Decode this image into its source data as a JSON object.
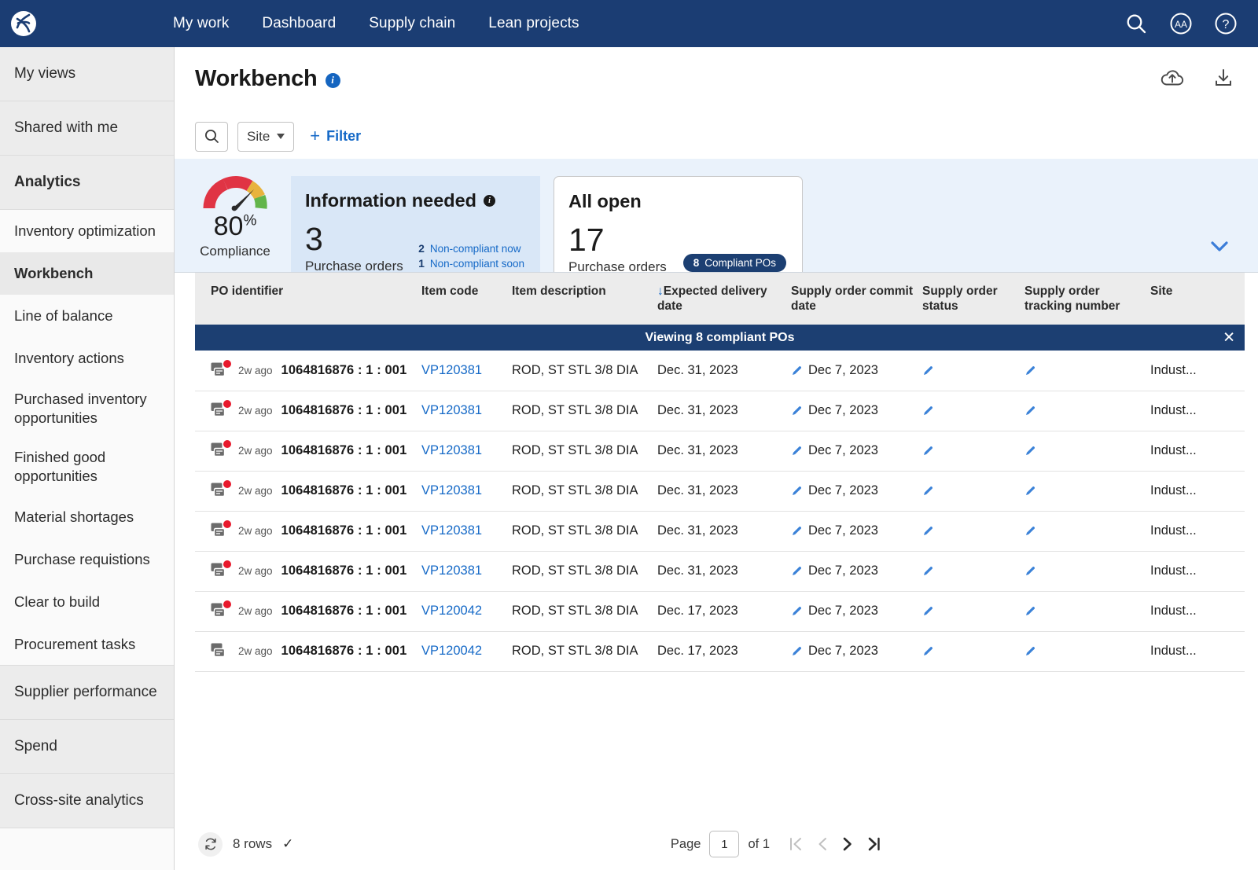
{
  "topnav": {
    "logo_icon": "brand-logo-icon",
    "links": [
      {
        "label": "My work"
      },
      {
        "label": "Dashboard"
      },
      {
        "label": "Supply chain"
      },
      {
        "label": "Lean projects"
      }
    ],
    "actions": [
      {
        "icon": "search-icon"
      },
      {
        "icon": "text-size-aa-icon"
      },
      {
        "icon": "help-question-icon"
      }
    ],
    "bg_color": "#1b3d73"
  },
  "sidebar": {
    "items": [
      {
        "label": "My views",
        "type": "group"
      },
      {
        "label": "Shared with me",
        "type": "group"
      },
      {
        "label": "Analytics",
        "type": "group-bold"
      },
      {
        "label": "Inventory optimization",
        "type": "sub"
      },
      {
        "label": "Workbench",
        "type": "sub-active"
      },
      {
        "label": "Line of balance",
        "type": "sub"
      },
      {
        "label": "Inventory actions",
        "type": "sub"
      },
      {
        "label": "Purchased inventory opportunities",
        "type": "sub2"
      },
      {
        "label": "Finished good opportunities",
        "type": "sub2"
      },
      {
        "label": "Material shortages",
        "type": "sub"
      },
      {
        "label": "Purchase requistions",
        "type": "sub"
      },
      {
        "label": "Clear to build",
        "type": "sub"
      },
      {
        "label": "Procurement tasks",
        "type": "sub-last"
      },
      {
        "label": "Supplier performance",
        "type": "group"
      },
      {
        "label": "Spend",
        "type": "group"
      },
      {
        "label": "Cross-site analytics",
        "type": "group"
      }
    ]
  },
  "header": {
    "title": "Workbench",
    "info_badge": "i",
    "actions": [
      {
        "icon": "cloud-upload-icon"
      },
      {
        "icon": "download-icon"
      }
    ]
  },
  "toolbar": {
    "search_icon": "search-icon",
    "site_label": "Site",
    "filter_label": "Filter",
    "filter_plus": "+"
  },
  "kpis": {
    "gauge": {
      "value": "80",
      "unit": "%",
      "label": "Compliance",
      "percent": 80,
      "colors": {
        "red": "#e03444",
        "amber": "#e8b33d",
        "green": "#62b54a"
      }
    },
    "info_card": {
      "title": "Information needed",
      "info_badge": "i",
      "count": "3",
      "subtitle": "Purchase orders",
      "breakdown": [
        {
          "count": "2",
          "label": "Non-compliant now"
        },
        {
          "count": "1",
          "label": "Non-compliant soon"
        }
      ]
    },
    "open_card": {
      "title": "All open",
      "count": "17",
      "subtitle": "Purchase orders",
      "badge_count": "8",
      "badge_label": "Compliant POs"
    },
    "expand_icon": "chevron-down-icon"
  },
  "table": {
    "columns": [
      {
        "label": "PO identifier",
        "sorted": false
      },
      {
        "label": "Item code",
        "sorted": false
      },
      {
        "label": "Item description",
        "sorted": false
      },
      {
        "label": "Expected delivery date",
        "sorted": true,
        "sort_arrow": "↓"
      },
      {
        "label": "Supply order commit date",
        "sorted": false
      },
      {
        "label": "Supply order status",
        "sorted": false
      },
      {
        "label": "Supply order tracking number",
        "sorted": false
      },
      {
        "label": "Site",
        "sorted": false
      }
    ],
    "banner": {
      "text": "Viewing 8 compliant POs",
      "close_icon": "close-icon"
    },
    "rows": [
      {
        "comment_icon": "comment-icon",
        "has_alert": true,
        "ago": "2w ago",
        "po_identifier": "1064816876 : 1 : 001",
        "item_code": "VP120381",
        "item_description": "ROD, ST STL 3/8 DIA",
        "expected_delivery_date": "Dec. 31, 2023",
        "commit_date": "Dec 7, 2023",
        "status": "",
        "tracking_number": "",
        "site": "Indust..."
      },
      {
        "comment_icon": "comment-icon",
        "has_alert": true,
        "ago": "2w ago",
        "po_identifier": "1064816876 : 1 : 001",
        "item_code": "VP120381",
        "item_description": "ROD, ST STL 3/8 DIA",
        "expected_delivery_date": "Dec. 31, 2023",
        "commit_date": "Dec 7, 2023",
        "status": "",
        "tracking_number": "",
        "site": "Indust..."
      },
      {
        "comment_icon": "comment-icon",
        "has_alert": true,
        "ago": "2w ago",
        "po_identifier": "1064816876 : 1 : 001",
        "item_code": "VP120381",
        "item_description": "ROD, ST STL 3/8 DIA",
        "expected_delivery_date": "Dec. 31, 2023",
        "commit_date": "Dec 7, 2023",
        "status": "",
        "tracking_number": "",
        "site": "Indust..."
      },
      {
        "comment_icon": "comment-icon",
        "has_alert": true,
        "ago": "2w ago",
        "po_identifier": "1064816876 : 1 : 001",
        "item_code": "VP120381",
        "item_description": "ROD, ST STL 3/8 DIA",
        "expected_delivery_date": "Dec. 31, 2023",
        "commit_date": "Dec 7, 2023",
        "status": "",
        "tracking_number": "",
        "site": "Indust..."
      },
      {
        "comment_icon": "comment-icon",
        "has_alert": true,
        "ago": "2w ago",
        "po_identifier": "1064816876 : 1 : 001",
        "item_code": "VP120381",
        "item_description": "ROD, ST STL 3/8 DIA",
        "expected_delivery_date": "Dec. 31, 2023",
        "commit_date": "Dec 7, 2023",
        "status": "",
        "tracking_number": "",
        "site": "Indust..."
      },
      {
        "comment_icon": "comment-icon",
        "has_alert": true,
        "ago": "2w ago",
        "po_identifier": "1064816876 : 1 : 001",
        "item_code": "VP120381",
        "item_description": "ROD, ST STL 3/8 DIA",
        "expected_delivery_date": "Dec. 31, 2023",
        "commit_date": "Dec 7, 2023",
        "status": "",
        "tracking_number": "",
        "site": "Indust..."
      },
      {
        "comment_icon": "comment-icon",
        "has_alert": true,
        "ago": "2w ago",
        "po_identifier": "1064816876 : 1 : 001",
        "item_code": "VP120042",
        "item_description": "ROD, ST STL 3/8 DIA",
        "expected_delivery_date": "Dec. 17, 2023",
        "commit_date": "Dec 7, 2023",
        "status": "",
        "tracking_number": "",
        "site": "Indust..."
      },
      {
        "comment_icon": "comment-icon",
        "has_alert": false,
        "ago": "2w ago",
        "po_identifier": "1064816876 : 1 : 001",
        "item_code": "VP120042",
        "item_description": "ROD, ST STL 3/8 DIA",
        "expected_delivery_date": "Dec. 17, 2023",
        "commit_date": "Dec 7, 2023",
        "status": "",
        "tracking_number": "",
        "site": "Indust..."
      }
    ]
  },
  "footer": {
    "refresh_icon": "refresh-icon",
    "rows_label": "8 rows",
    "check_icon": "check-icon",
    "page_label": "Page",
    "page_value": "1",
    "of_label": "of 1",
    "nav": [
      {
        "icon": "first-page-icon",
        "disabled": true
      },
      {
        "icon": "prev-page-icon",
        "disabled": true
      },
      {
        "icon": "next-page-icon",
        "disabled": false
      },
      {
        "icon": "last-page-icon",
        "disabled": false
      }
    ]
  }
}
